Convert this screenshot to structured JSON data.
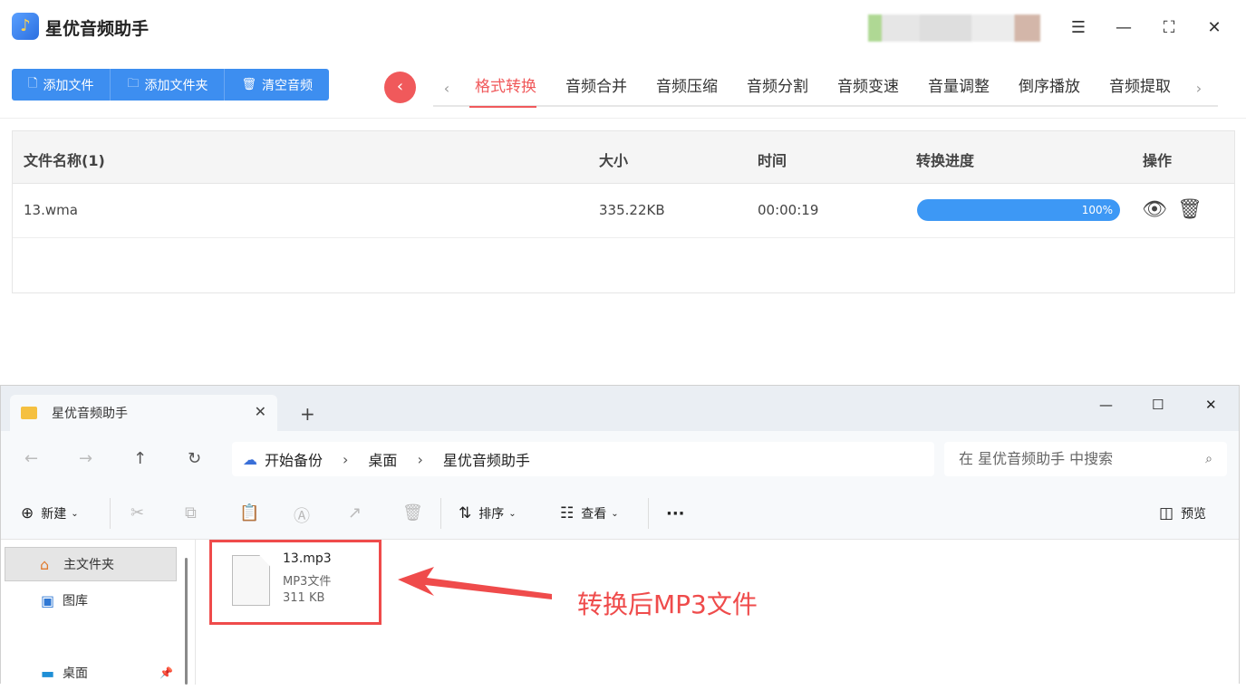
{
  "app": {
    "title": "星优音频助手",
    "toolbar": [
      {
        "icon": "file-icon",
        "glyph": "🗋",
        "label": "添加文件"
      },
      {
        "icon": "folder-icon",
        "glyph": "🗀",
        "label": "添加文件夹"
      },
      {
        "icon": "trash-icon",
        "glyph": "🗑",
        "label": "清空音频"
      }
    ],
    "tabs": [
      "格式转换",
      "音频合并",
      "音频压缩",
      "音频分割",
      "音频变速",
      "音量调整",
      "倒序播放",
      "音频提取"
    ],
    "active_tab": "格式转换",
    "accent_color": "#f0595b",
    "table": {
      "headers": {
        "name": "文件名称(1)",
        "size": "大小",
        "time": "时间",
        "progress": "转换进度",
        "ops": "操作"
      },
      "rows": [
        {
          "name": "13.wma",
          "size": "335.22KB",
          "time": "00:00:19",
          "progress_label": "100%",
          "progress": 1.0
        }
      ]
    }
  },
  "explorer": {
    "tab_title": "星优音频助手",
    "breadcrumb": [
      "开始备份",
      "桌面",
      "星优音频助手"
    ],
    "search_placeholder": "在 星优音频助手 中搜索",
    "commands": {
      "new": "新建",
      "sort": "排序",
      "view": "查看",
      "more": "···",
      "preview": "预览"
    },
    "nav": [
      {
        "label": "主文件夹",
        "icon": "home-icon"
      },
      {
        "label": "图库",
        "icon": "gallery-icon"
      },
      {
        "label": "桌面",
        "icon": "desktop-icon"
      }
    ],
    "file": {
      "name": "13.mp3",
      "type": "MP3文件",
      "size": "311 KB"
    },
    "annotation": "转换后MP3文件",
    "annotation_color": "#ef4b4b"
  }
}
